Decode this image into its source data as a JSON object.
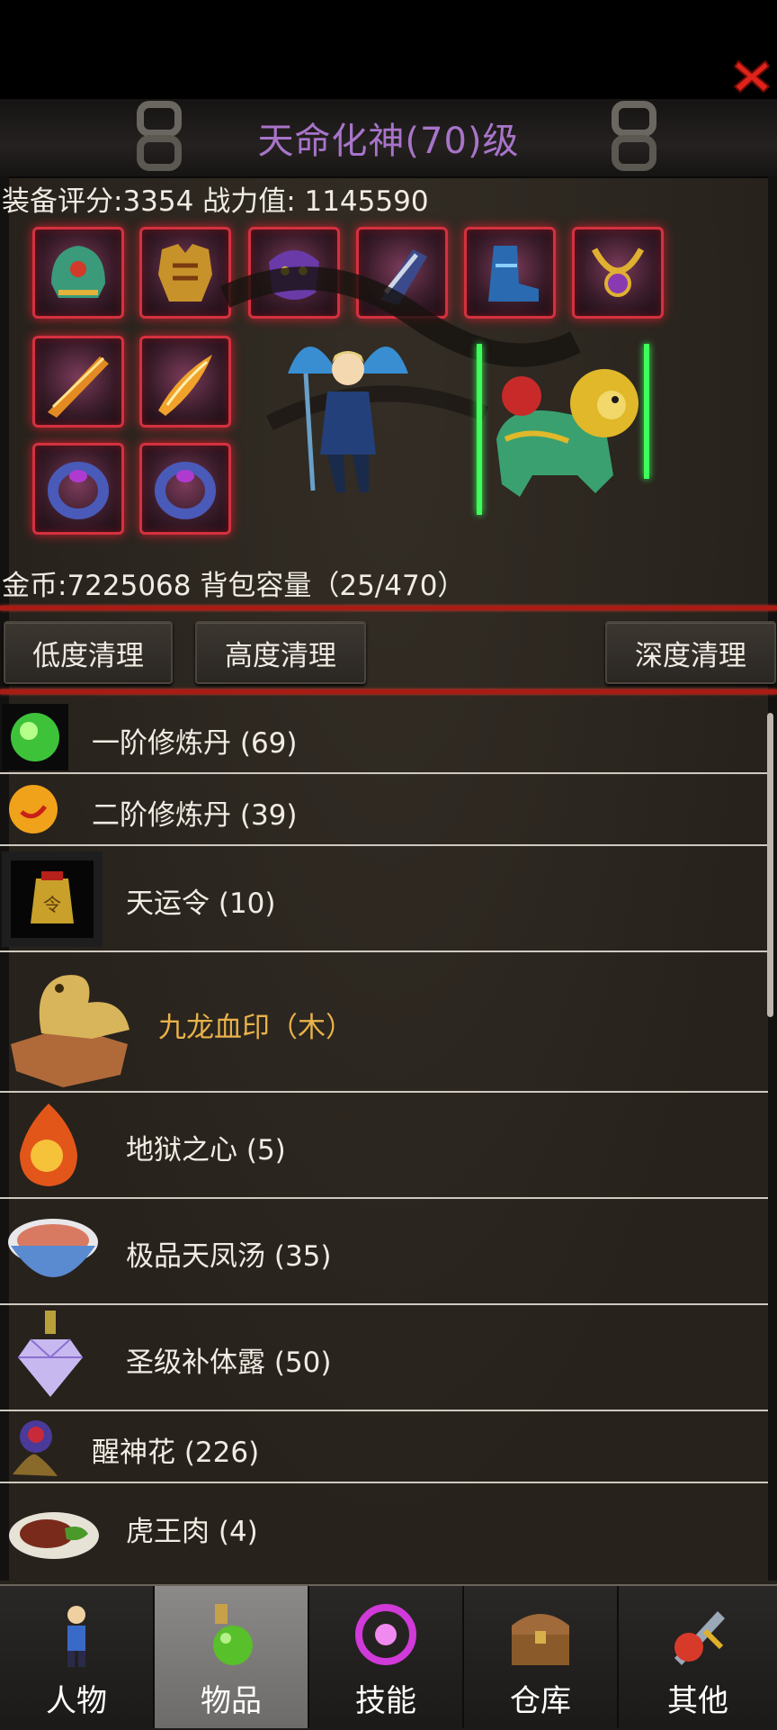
{
  "header": {
    "title": "天命化神(70)级"
  },
  "stats": {
    "text": "装备评分:3354 战力值:  1145590"
  },
  "inventory": {
    "text": "金币:7225068 背包容量（25/470）"
  },
  "cleanup": {
    "low": "低度清理",
    "high": "高度清理",
    "deep": "深度清理"
  },
  "items": [
    {
      "label": "一阶修炼丹 (69)",
      "icon": "green-pill-icon"
    },
    {
      "label": "二阶修炼丹 (39)",
      "icon": "orange-pill-icon"
    },
    {
      "label": "天运令 (10)",
      "icon": "token-icon"
    },
    {
      "label": "九龙血印（木）",
      "icon": "dragon-seal-icon",
      "highlight": true
    },
    {
      "label": "地狱之心 (5)",
      "icon": "fire-heart-icon"
    },
    {
      "label": "极品天凤汤 (35)",
      "icon": "soup-bowl-icon"
    },
    {
      "label": "圣级补体露 (50)",
      "icon": "crystal-icon"
    },
    {
      "label": "醒神花 (226)",
      "icon": "flower-icon"
    },
    {
      "label": "虎王肉 (4)",
      "icon": "meat-icon"
    }
  ],
  "tabs": [
    {
      "label": "人物",
      "icon": "character-icon",
      "active": false
    },
    {
      "label": "物品",
      "icon": "potion-icon",
      "active": true
    },
    {
      "label": "技能",
      "icon": "skill-icon",
      "active": false
    },
    {
      "label": "仓库",
      "icon": "chest-icon",
      "active": false
    },
    {
      "label": "其他",
      "icon": "other-icon",
      "active": false
    }
  ],
  "colors": {
    "title": "#a874c9",
    "highlight_item": "#e9b24a",
    "slot_border": "#d4313e",
    "rule": "#a81c14"
  }
}
